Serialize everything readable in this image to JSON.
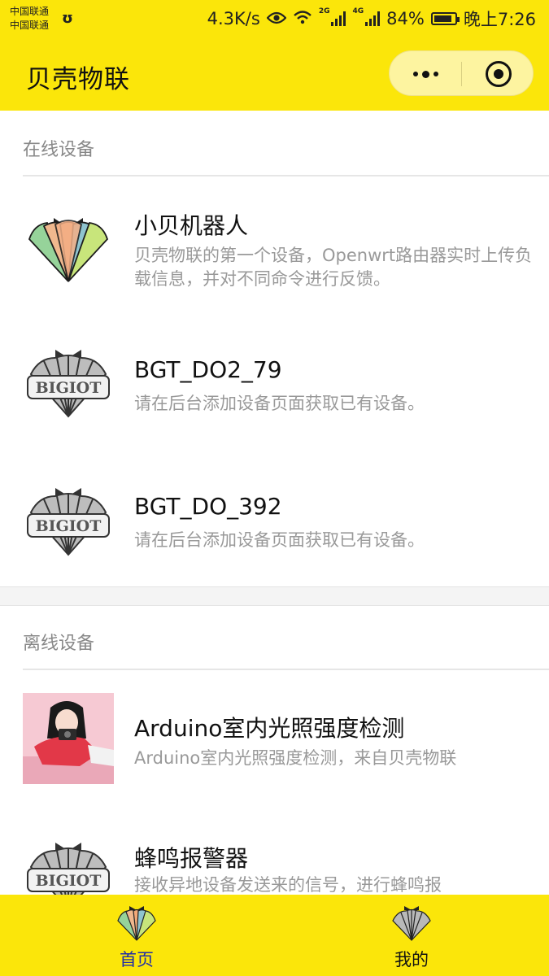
{
  "status_bar": {
    "carrier_1": "中国联通",
    "carrier_2": "中国联通",
    "speed": "4.3K/s",
    "net_tag_1": "2G",
    "net_tag_2": "4G",
    "battery": "84%",
    "time": "晚上7:26"
  },
  "nav": {
    "title": "贝壳物联"
  },
  "sections": {
    "online": {
      "title": "在线设备",
      "items": [
        {
          "name": "小贝机器人",
          "desc": "贝壳物联的第一个设备，Openwrt路由器实时上传负载信息，并对不同命令进行反馈。",
          "icon": "shell-logo-color"
        },
        {
          "name": "BGT_DO2_79",
          "desc": "请在后台添加设备页面获取已有设备。",
          "icon": "shell-logo-bigiot",
          "logo_text": "BIGIOT"
        },
        {
          "name": "BGT_DO_392",
          "desc": "请在后台添加设备页面获取已有设备。",
          "icon": "shell-logo-bigiot",
          "logo_text": "BIGIOT"
        }
      ]
    },
    "offline": {
      "title": "离线设备",
      "items": [
        {
          "name": "Arduino室内光照强度检测",
          "desc": "Arduino室内光照强度检测，来自贝壳物联",
          "icon": "user-photo"
        },
        {
          "name": "蜂鸣报警器",
          "desc": "接收异地设备发送来的信号，进行蜂鸣报",
          "icon": "shell-logo-bigiot",
          "logo_text": "BIGIOT"
        }
      ]
    }
  },
  "tabbar": {
    "tabs": [
      {
        "label": "首页",
        "active": true,
        "icon": "shell-color-icon"
      },
      {
        "label": "我的",
        "active": false,
        "icon": "shell-gray-icon"
      }
    ]
  },
  "colors": {
    "brand_yellow": "#fbe60a",
    "active_tab": "#1f2ca8",
    "muted_text": "#999999"
  }
}
